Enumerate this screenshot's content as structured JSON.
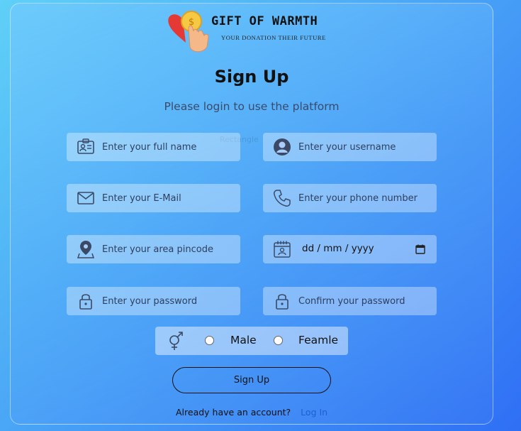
{
  "brand": {
    "name": "GIFT OF WARMTH",
    "tagline": "YOUR DONATION THEIR FUTURE"
  },
  "heading": "Sign Up",
  "subheading": "Please login to use the platform",
  "watermark": "Rectangle",
  "fields": {
    "full_name": {
      "placeholder": "Enter your full name",
      "icon": "id-card-icon"
    },
    "username": {
      "placeholder": "Enter your username",
      "icon": "user-avatar-icon"
    },
    "email": {
      "placeholder": "Enter your E-Mail",
      "icon": "mail-icon"
    },
    "phone": {
      "placeholder": "Enter your phone number",
      "icon": "phone-icon"
    },
    "pincode": {
      "placeholder": "Enter your area pincode",
      "icon": "location-pin-icon"
    },
    "dob": {
      "value": "dd / mm / yyyy",
      "icon": "calendar-user-icon"
    },
    "password": {
      "placeholder": "Enter your password",
      "icon": "lock-icon"
    },
    "confirm_password": {
      "placeholder": "Confirm your password",
      "icon": "lock-icon"
    }
  },
  "gender": {
    "icon": "gender-icon",
    "options": [
      "Male",
      "Feamle"
    ]
  },
  "signup_button": "Sign Up",
  "footer": {
    "text": "Already have an account?",
    "link": "Log In"
  },
  "colors": {
    "link": "#1f5fd0",
    "heart": "#e53935",
    "coin": "#f6c945"
  }
}
